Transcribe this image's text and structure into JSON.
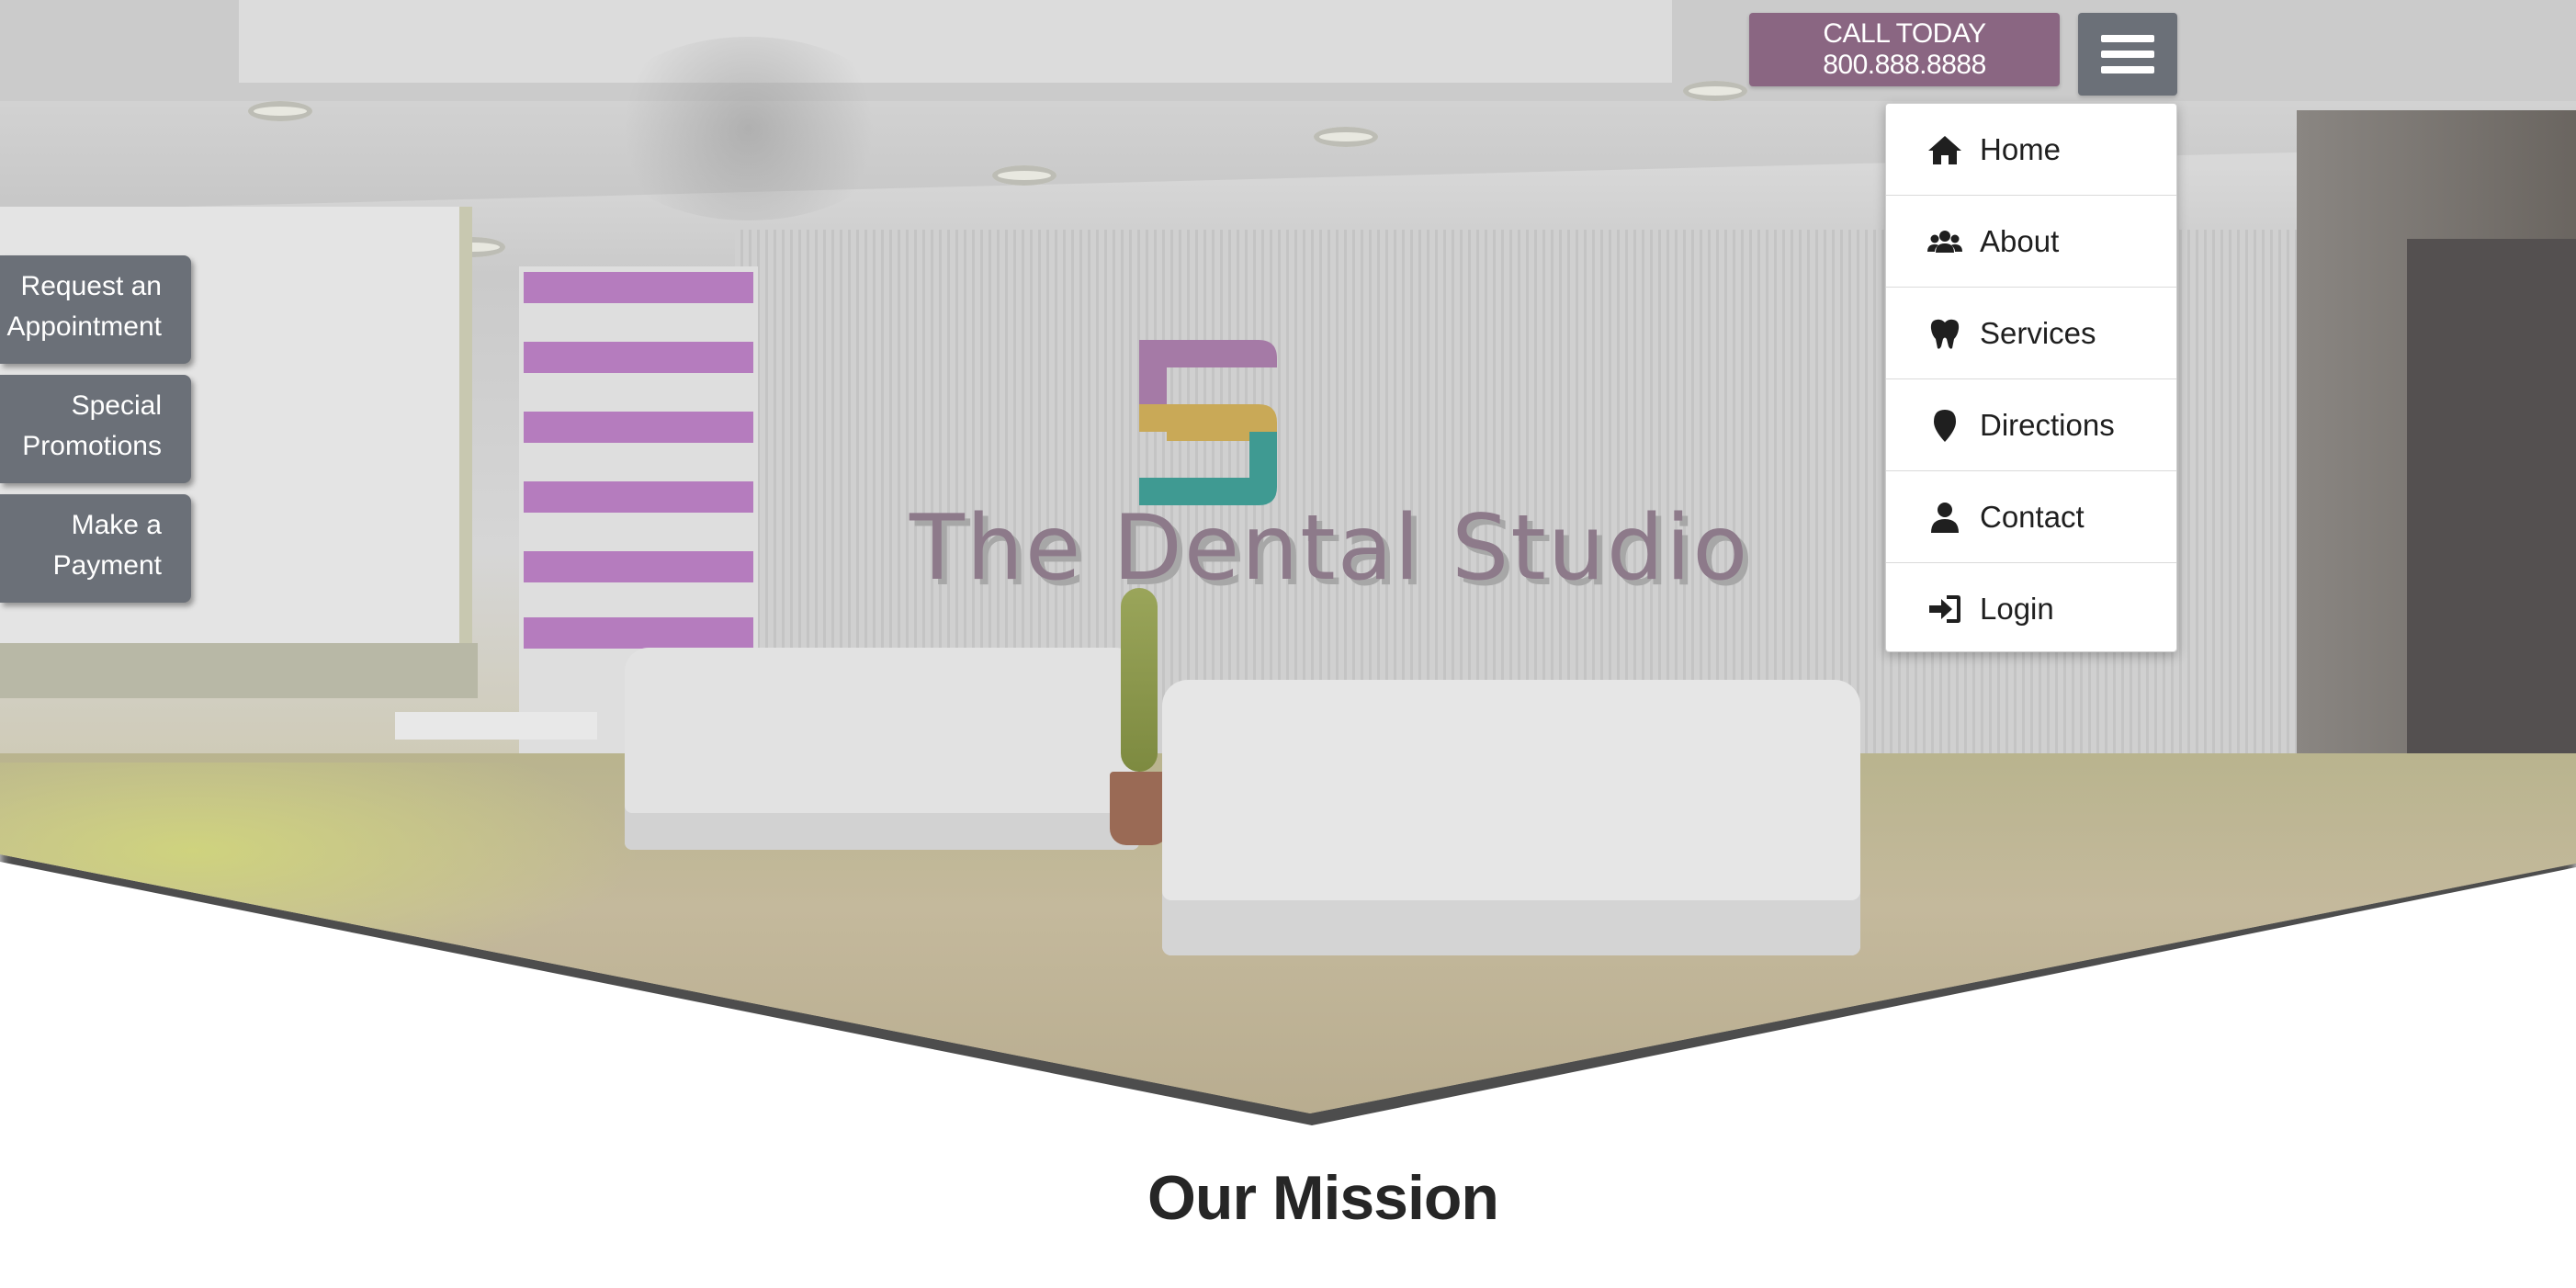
{
  "header": {
    "call_label": "CALL TODAY 800.888.8888",
    "menu_icon": "hamburger-menu-icon"
  },
  "hero": {
    "wall_sign_text": "The Dental Studio"
  },
  "nav_menu": {
    "items": [
      {
        "label": "Home",
        "icon": "home-icon"
      },
      {
        "label": "About",
        "icon": "users-icon"
      },
      {
        "label": "Services",
        "icon": "tooth-icon"
      },
      {
        "label": "Directions",
        "icon": "map-pin-icon"
      },
      {
        "label": "Contact",
        "icon": "user-icon"
      },
      {
        "label": "Login",
        "icon": "sign-in-icon"
      }
    ]
  },
  "side_tabs": [
    {
      "line1": "Request an",
      "line2": "Appointment"
    },
    {
      "line1": "Special",
      "line2": "Promotions"
    },
    {
      "line1": "Make a",
      "line2": "Payment"
    }
  ],
  "mission": {
    "title": "Our Mission"
  },
  "colors": {
    "call_button": "#8a6682",
    "menu_button": "#6b7078",
    "side_tab": "#6b7078",
    "title_text": "#262626"
  }
}
